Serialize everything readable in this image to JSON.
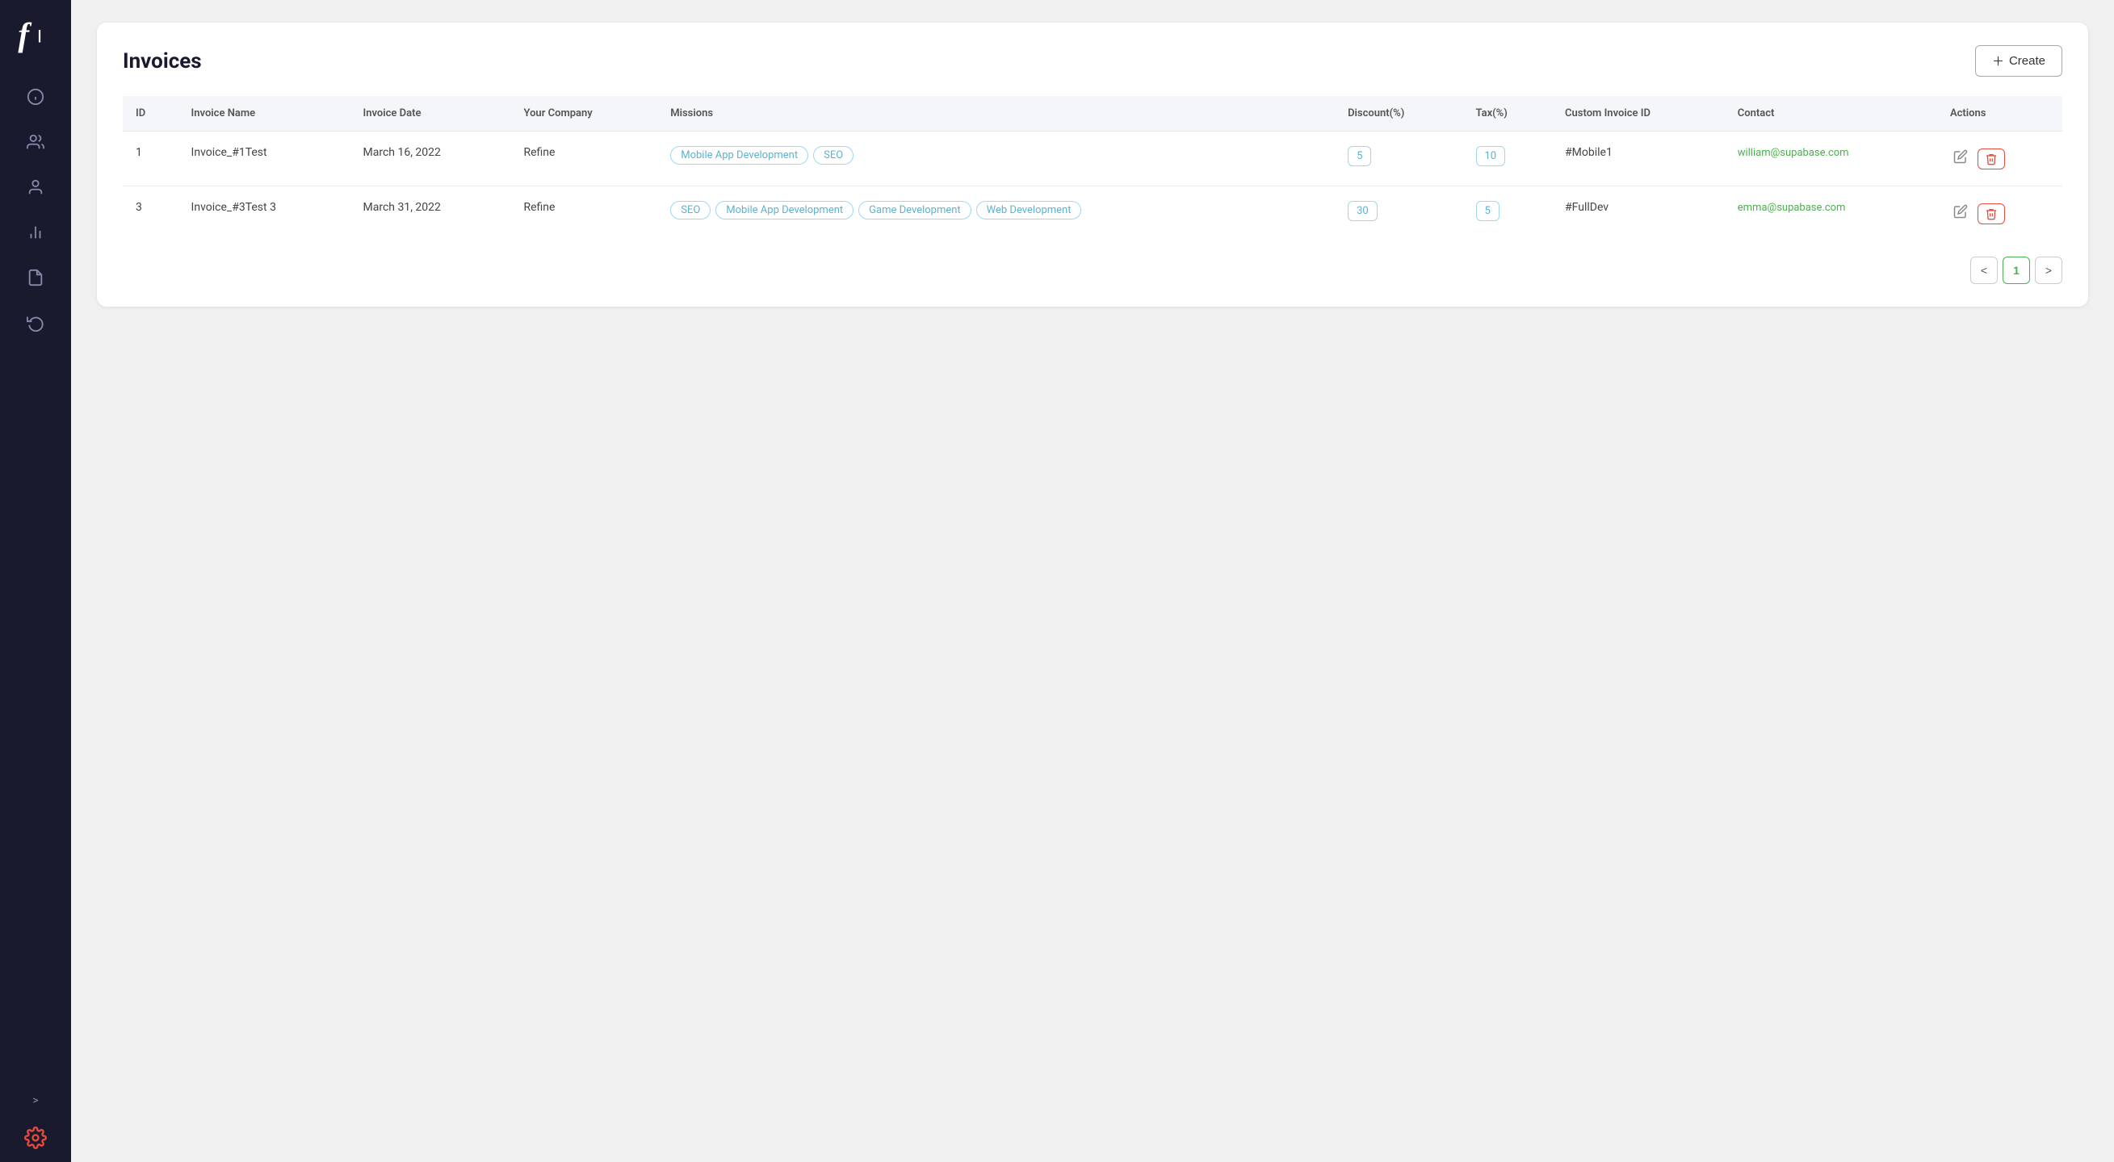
{
  "sidebar": {
    "logo": "f|",
    "expand_label": ">",
    "icons": [
      {
        "name": "info-icon",
        "label": "Info"
      },
      {
        "name": "users-icon",
        "label": "Users"
      },
      {
        "name": "user-icon",
        "label": "User"
      },
      {
        "name": "analytics-icon",
        "label": "Analytics"
      },
      {
        "name": "document-icon",
        "label": "Document"
      },
      {
        "name": "refresh-icon",
        "label": "Refresh"
      }
    ]
  },
  "header": {
    "title": "Invoices",
    "create_button": "Create"
  },
  "table": {
    "columns": [
      "ID",
      "Invoice Name",
      "Invoice Date",
      "Your Company",
      "Missions",
      "Discount(%)",
      "Tax(%)",
      "Custom Invoice ID",
      "Contact",
      "Actions"
    ],
    "rows": [
      {
        "id": "1",
        "invoice_name": "Invoice_#1Test",
        "invoice_date": "March 16, 2022",
        "company": "Refine",
        "missions": [
          "Mobile App Development",
          "SEO"
        ],
        "discount": "5",
        "tax": "10",
        "custom_invoice_id": "#Mobile1",
        "contact": "william@supabase.com"
      },
      {
        "id": "3",
        "invoice_name": "Invoice_#3Test 3",
        "invoice_date": "March 31, 2022",
        "company": "Refine",
        "missions": [
          "SEO",
          "Mobile App Development",
          "Game Development",
          "Web Development"
        ],
        "discount": "30",
        "tax": "5",
        "custom_invoice_id": "#FullDev",
        "contact": "emma@supabase.com"
      }
    ]
  },
  "pagination": {
    "prev_label": "<",
    "next_label": ">",
    "current_page": "1"
  },
  "actions": {
    "edit_label": "✎",
    "delete_label": "🗑"
  }
}
